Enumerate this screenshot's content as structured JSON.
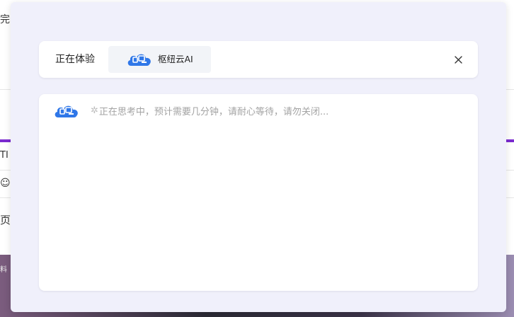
{
  "background": {
    "fragment_top": "完",
    "fragment_mid": "TI",
    "fragment_page": "页面",
    "fragment_photo": "料"
  },
  "modal": {
    "header": {
      "experience_label": "正在体验",
      "model_name": "枢纽云AI",
      "close_icon": "close-icon"
    },
    "content": {
      "spinner_icon": "loading-spinner-icon",
      "status_text": "正在思考中，预计需要几分钟，请耐心等待，请勿关闭..."
    }
  },
  "colors": {
    "modal_bg": "#f0f0fb",
    "card_bg": "#ffffff",
    "logo_blue": "#2f77e8",
    "accent_purple": "#7b2bd0",
    "status_text": "#a3a3a3"
  }
}
